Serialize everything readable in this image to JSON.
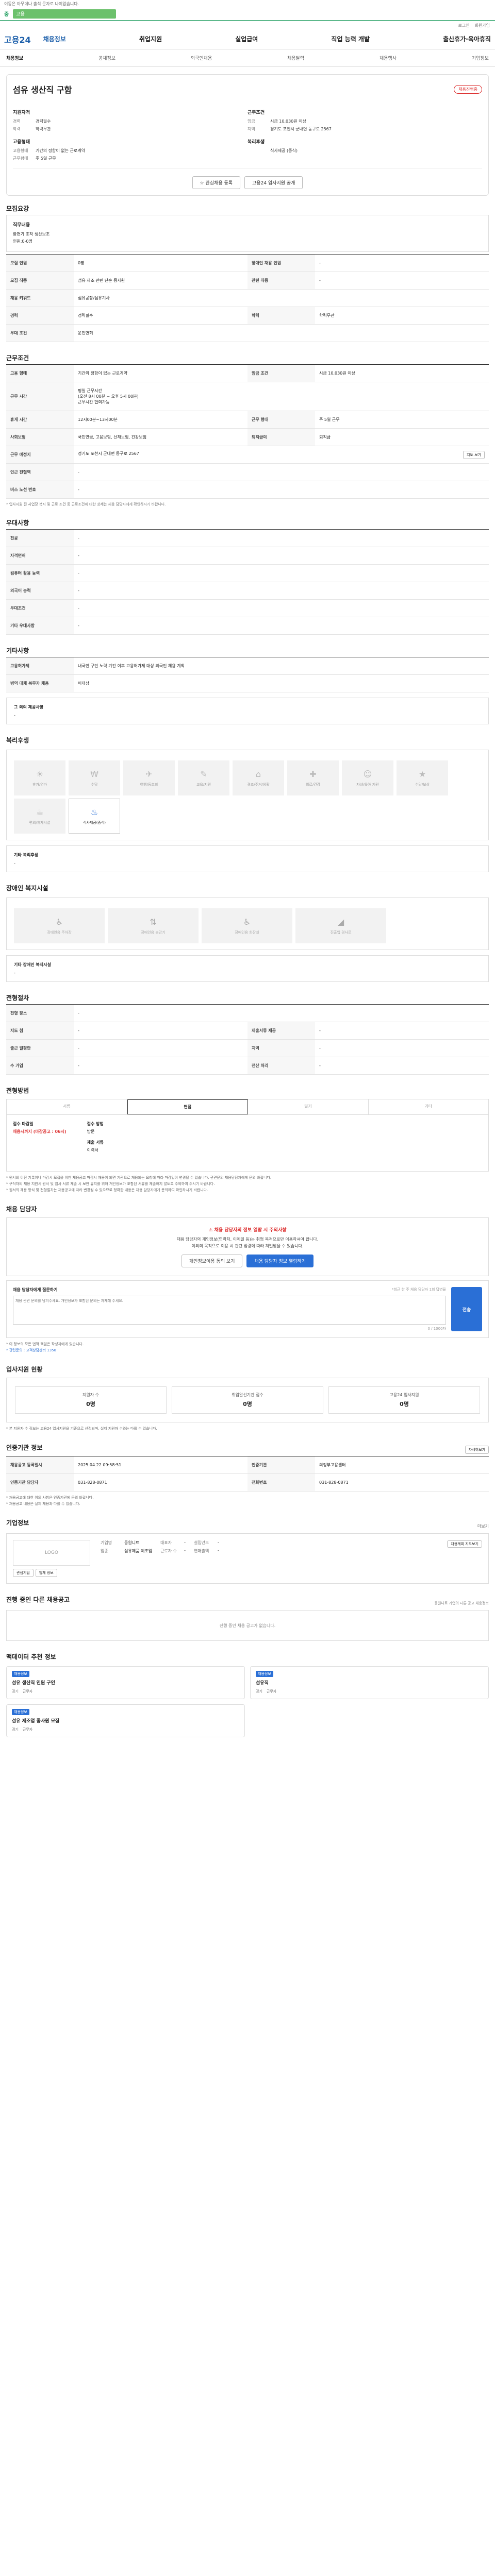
{
  "notice": "이동은 아무데나 출석 문자로 나이없습니다.",
  "topbar": {
    "brand_small": "중",
    "search_value": "고용"
  },
  "util": [
    "로그인",
    "회원가입"
  ],
  "logo": "고용24",
  "gnb": [
    "채용정보",
    "취업지원",
    "실업급여",
    "직업 능력 개발",
    "출산휴가·육아휴직"
  ],
  "subnav": [
    "채용정보",
    "공채정보",
    "외국인채용",
    "채용달력",
    "채용행사",
    "기업정보"
  ],
  "header": {
    "company": "",
    "title": "섬유 생산직 구함",
    "status_pill": "채용진행중",
    "left_heading": "지원자격",
    "left_rows": [
      [
        "경력",
        "경력필수"
      ],
      [
        "학력",
        "학력무관"
      ]
    ],
    "left_heading2": "고용형태",
    "left_rows2": [
      [
        "고용형태",
        "기간의 정함이 없는 근로계약"
      ],
      [
        "근무형태",
        "주 5일 근무"
      ]
    ],
    "right_heading": "근무조건",
    "right_rows": [
      [
        "임금",
        "시급 10,030원 이상"
      ],
      [
        "지역",
        "경기도 포천시 군내면 동구로 2567"
      ]
    ],
    "right_heading2": "복리후생",
    "right_rows2": [
      [
        "",
        "식사제공 (중식)"
      ]
    ],
    "btn_star": "관심채용 등록",
    "btn_share": "고용24 입사지원 공개"
  },
  "recruit": {
    "title": "모집요강",
    "desc_heading": "직무내용",
    "desc_lines": [
      "환편기 조작 생산보조",
      "인원:0-0명"
    ],
    "rows": [
      [
        [
          "모집 인원",
          "0명"
        ],
        [
          "장애인 채용 인원",
          "-"
        ]
      ],
      [
        [
          "모집 직종",
          "섬유 제조 관련 단순 종사원"
        ],
        [
          "관련 직종",
          "-"
        ]
      ],
      [
        [
          "채용 키워드",
          "섬유공장/섬유기사"
        ],
        null
      ],
      [
        [
          "경력",
          "경력필수"
        ],
        [
          "학력",
          "학력무관"
        ]
      ],
      [
        [
          "우대 조건",
          "운전면허"
        ],
        null
      ]
    ]
  },
  "work": {
    "title": "근무조건",
    "rows": [
      [
        [
          "고용 형태",
          "기간의 정함이 없는 근로계약"
        ],
        [
          "임금 조건",
          "시급 10,030원 이상"
        ]
      ],
      [
        [
          "근무 시간",
          "평일 근무시간\n(오전 8시 00분 ~ 오후 5시 00분)\n근무시간 협의가능"
        ],
        null
      ],
      [
        [
          "휴게 시간",
          "12시00분~13시00분"
        ],
        [
          "근무 형태",
          "주 5일 근무"
        ]
      ],
      [
        [
          "사회보험",
          "국민연금, 고용보험, 산재보험, 건강보험"
        ],
        [
          "퇴직급여",
          "퇴직금"
        ]
      ],
      [
        [
          "근무 예정지",
          "경기도 포천시 군내면 동구로 2567"
        ],
        null
      ],
      [
        [
          "인근 전철역",
          "-"
        ],
        null
      ],
      [
        [
          "버스 노선 번호",
          "-"
        ],
        null
      ]
    ],
    "map_btn": "지도 보기",
    "note": "* 입사지원 전 사업장 복지 및 근로 조건 등 근로조건에 대한 상세는 채용 담당자에게 확인하시기 바랍니다."
  },
  "prefer": {
    "title": "우대사항",
    "rows": [
      [
        "전공",
        "-"
      ],
      [
        "자격면허",
        "-"
      ],
      [
        "컴퓨터 활용 능력",
        "-"
      ],
      [
        "외국어 능력",
        "-"
      ],
      [
        "우대조건",
        "-"
      ],
      [
        "기타 우대사항",
        "-"
      ]
    ]
  },
  "etc": {
    "title": "기타사항",
    "rows": [
      [
        "고용허가제",
        "내국인 구인 노력 기간 이후 고용허가제 대상 외국인 채용 계획"
      ],
      [
        "병역 대체 복무자 채용",
        "비대상"
      ]
    ],
    "box_heading": "그 외의 제공사항",
    "box_body": "-"
  },
  "welfare": {
    "title": "복리후생",
    "tiles": [
      {
        "label": "휴가/연가",
        "on": false
      },
      {
        "label": "수당",
        "on": false
      },
      {
        "label": "여행/동호회",
        "on": false
      },
      {
        "label": "교육/지원",
        "on": false
      },
      {
        "label": "경조/주거/생활",
        "on": false
      },
      {
        "label": "의료/건강",
        "on": false
      },
      {
        "label": "자녀/육아 지원",
        "on": false
      },
      {
        "label": "수당/보상",
        "on": false
      },
      {
        "label": "편의/휴게시설",
        "on": false
      },
      {
        "label": "식사제공(중식)",
        "on": true
      }
    ],
    "box_heading": "기타 복리후생",
    "box_body": "-"
  },
  "disab": {
    "title": "장애인 복지시설",
    "tiles": [
      "장애인용 주차장",
      "장애인용 승강기",
      "장애인용 화장실",
      "진출입 경사로"
    ],
    "box_heading": "기타 장애인 복지시설",
    "box_body": "-"
  },
  "process": {
    "title": "전형절차",
    "rows": [
      [
        [
          "전형 장소",
          "-"
        ],
        null
      ],
      [
        [
          "지도 첨",
          "-"
        ],
        [
          "제출서류 제공",
          "-"
        ]
      ],
      [
        [
          "출근 일정안",
          "-"
        ],
        [
          "지역",
          "-"
        ]
      ],
      [
        [
          "수 가입",
          "-"
        ],
        [
          "전산 처리",
          "-"
        ]
      ]
    ]
  },
  "method": {
    "title": "전형방법",
    "tabs": [
      "서류",
      "면접",
      "필기",
      "기타"
    ],
    "col1_h": "접수 마감일",
    "col1_v": "채용시까지 (마감공고 : 06시)",
    "col2_h": "접수 방법",
    "col2_v": "방문",
    "col3_h": "제출 서류",
    "col3_v": "이력서",
    "notes": [
      "* 원서의 이전 기록이나 마감시 모집을 위한 채용공고 마감시 채용이 되면 기관으로 채용되는 요청에 따라 마감일이 변경될 수 있습니다. 관련문의 채용담당자에게 문의 바랍니다.",
      "* 구직자의 채용 지원시 원서 및 입사 서류 제출 시 보안 유지를 위해 개인정보가 포함된 서류를 제출하지 않도록 주의하여 주시기 바랍니다.",
      "* 원서의 채용 방식 및 전형절차는 채용공고에 따라 변경될 수 있으므로 정확한 내용은 채용 담당자에게 문의하여 확인하시기 바랍니다."
    ]
  },
  "contact": {
    "title": "채용 담당자",
    "warn": "채용 담당자의 정보 열람 시 주의사항",
    "lines": [
      "채용 담당자의 개인정보(연락처, 이메일 등)는 취업 목적으로만 이용하셔야 합니다.",
      "이외의 목적으로 이용 시 관련 법령에 따라 처벌받을 수 있습니다."
    ],
    "btn1": "개인정보이용 동의 보기",
    "btn2": "채용 담당자 정보 열람하기"
  },
  "inquiry": {
    "label": "채용 담당자에게 질문하기",
    "sub": "*최근 한 주 채용 담당자 1회 답변율",
    "placeholder": "채용 관련 문의를 남겨주세요. 개인정보가 포함된 문의는 자제해 주세요.",
    "count": "0 / 1000자",
    "send": "전송",
    "notes": [
      "* 이 정보의 모든 법적 책임은 작성자에게 있습니다.",
      "* 관련문의 : 고객상담센터 1350"
    ]
  },
  "apply_status": {
    "title": "입사지원 현황",
    "cards": [
      {
        "label": "지원자 수",
        "value": "0명"
      },
      {
        "label": "취업알선기관 접수",
        "value": "0명"
      },
      {
        "label": "고용24 입사지원",
        "value": "0명"
      }
    ],
    "note": "* 본 지원자 수 정보는 고용24 입사지원을 기준으로 산정되며, 실제 지원자 수와는 다를 수 있습니다."
  },
  "info": {
    "title": "인증기관 정보",
    "btn": "자세히보기",
    "rows": [
      [
        [
          "채용공고 등록일시",
          "2025.04.22 09:58:51"
        ],
        [
          "인증기관",
          "의정부고용센터"
        ]
      ],
      [
        [
          "인증기관 담당자",
          "031-828-0871"
        ],
        [
          "전화번호",
          "031-828-0871"
        ]
      ]
    ],
    "notes": [
      "* 채용공고에 대한 이의 사항은 인증기관에 문의 바랍니다.",
      "* 채용공고 내용은 실제 채용과 다를 수 있습니다."
    ]
  },
  "corp": {
    "title": "기업정보",
    "more": "더보기",
    "logo_text": "LOGO",
    "btn1": "관심기업",
    "btn2": "업체 정보",
    "rows1": [
      [
        "기업명",
        "동원니트"
      ],
      [
        "업종",
        "섬유제품 제조업"
      ]
    ],
    "rows2": [
      [
        "대표자",
        "-"
      ],
      [
        "근로자 수",
        "-"
      ]
    ],
    "rows3": [
      [
        "설립년도",
        "-"
      ],
      [
        "연매출액",
        "-"
      ]
    ],
    "map_btn": "채용계획 지도보기"
  },
  "others": {
    "title": "진행 중인 다른 채용공고",
    "sub": "동원니트 기업의 다른 공고 채용정보",
    "empty": "진행 중인 채용 공고가 없습니다."
  },
  "recommend": {
    "title": "맥데이터 추천 정보",
    "cards": [
      {
        "badge": "채용정보",
        "co": "",
        "title": "섬유 생산직 인원 구인",
        "meta": [
          "경기",
          "근무자"
        ]
      },
      {
        "badge": "채용정보",
        "co": "",
        "title": "섬유직",
        "meta": [
          "경기",
          "근무자"
        ]
      },
      {
        "badge": "채용정보",
        "co": "",
        "title": "섬유 제조업 종사원 모집",
        "meta": [
          "경기",
          "근무자"
        ]
      }
    ]
  }
}
